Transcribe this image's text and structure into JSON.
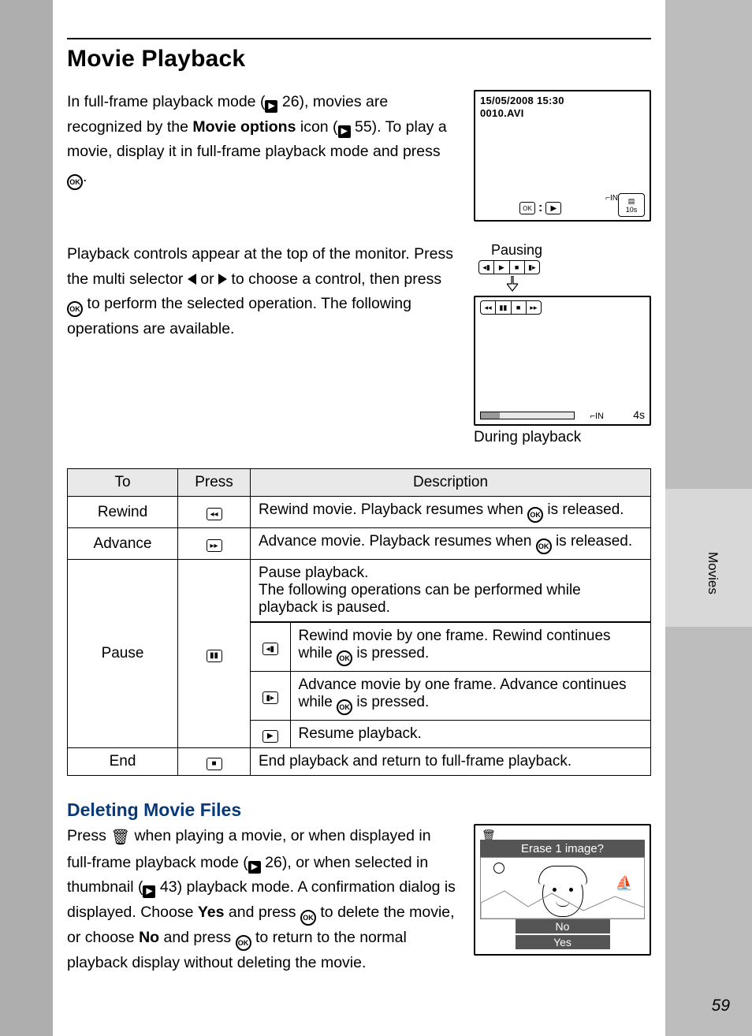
{
  "title": "Movie Playback",
  "side_tab": "Movies",
  "page_number": "59",
  "intro": {
    "p1_a": "In full-frame playback mode (",
    "p1_ref1": " 26), movies are recognized by the ",
    "p1_bold": "Movie options",
    "p1_b": " icon (",
    "p1_ref2": " 55). To play a movie, display it in full-frame playback mode and press ",
    "p1_end": "."
  },
  "lcd1": {
    "date": "15/05/2008 15:30",
    "file": "0010.AVI",
    "time": "10s",
    "in": "IN"
  },
  "para2": "Playback controls appear at the top of the monitor. Press the multi selector ",
  "para2_mid": " or ",
  "para2_b": " to choose a control, then press ",
  "para2_c": " to perform the selected operation. The following operations are available.",
  "diag2": {
    "pausing": "Pausing",
    "during": "During playback",
    "duration": "4s",
    "in": "IN"
  },
  "table": {
    "headers": {
      "to": "To",
      "press": "Press",
      "desc": "Description"
    },
    "rows": {
      "rewind": {
        "to": "Rewind",
        "desc_a": "Rewind movie. Playback resumes when ",
        "desc_b": " is released."
      },
      "advance": {
        "to": "Advance",
        "desc_a": "Advance movie. Playback resumes when ",
        "desc_b": " is released."
      },
      "pause": {
        "to": "Pause",
        "desc_top": "Pause playback.\nThe following operations can be performed while playback is paused.",
        "sub1_a": "Rewind movie by one frame. Rewind continues while ",
        "sub1_b": " is pressed.",
        "sub2_a": "Advance movie by one frame. Advance continues while ",
        "sub2_b": " is pressed.",
        "sub3": "Resume playback."
      },
      "end": {
        "to": "End",
        "desc": "End playback and return to full-frame playback."
      }
    }
  },
  "deleting": {
    "heading": "Deleting Movie Files",
    "p_a": "Press ",
    "p_b": " when playing a movie, or when displayed in full-frame playback mode (",
    "p_ref1": " 26), or when selected in thumbnail (",
    "p_ref2": " 43) playback mode. A confirmation dialog is displayed. Choose ",
    "yes": "Yes",
    "p_c": " and press ",
    "p_d": " to delete the movie, or choose ",
    "no": "No",
    "p_e": " and press ",
    "p_f": " to return to the normal playback display without deleting the movie."
  },
  "del_lcd": {
    "title": "Erase 1 image?",
    "no": "No",
    "yes": "Yes"
  }
}
